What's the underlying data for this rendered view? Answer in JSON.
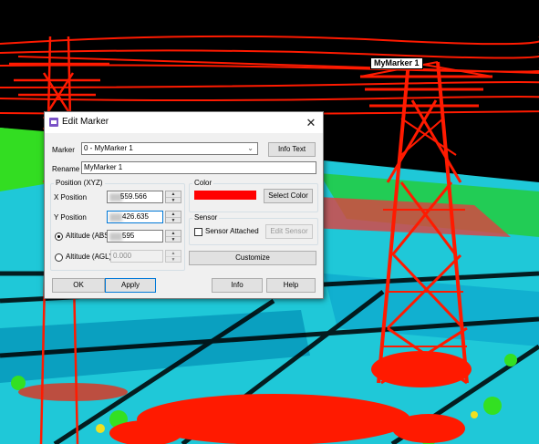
{
  "scene": {
    "marker_label": "MyMarker 1"
  },
  "dialog": {
    "title": "Edit Marker",
    "close_glyph": "✕",
    "marker": {
      "label": "Marker",
      "value": "0 - MyMarker 1",
      "info_text_button": "Info Text"
    },
    "rename": {
      "label": "Rename",
      "value": "MyMarker 1"
    },
    "position": {
      "group_label": "Position (XYZ)",
      "x": {
        "label": "X Position",
        "value": "559.566"
      },
      "y": {
        "label": "Y Position",
        "value": "426.635"
      },
      "altitude_abs": {
        "label": "Altitude (ABS)",
        "value": "595",
        "checked": true
      },
      "altitude_agl": {
        "label": "Altitude (AGL)",
        "value": "0.000",
        "checked": false
      }
    },
    "color": {
      "group_label": "Color",
      "value": "#ff0000",
      "select_button": "Select Color"
    },
    "sensor": {
      "group_label": "Sensor",
      "attached_label": "Sensor Attached",
      "edit_button": "Edit Sensor"
    },
    "customize_button": "Customize",
    "footer": {
      "ok": "OK",
      "apply": "Apply",
      "info": "Info",
      "help": "Help"
    }
  }
}
